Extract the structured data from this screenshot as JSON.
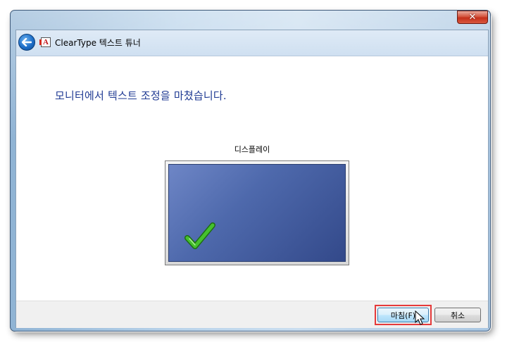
{
  "window": {
    "title": "ClearType 텍스트 튜너",
    "close_glyph": "✕"
  },
  "nav": {
    "back_icon": "back-arrow-icon",
    "app_icon_label": "A"
  },
  "main": {
    "heading": "모니터에서 텍스트 조정을 마쳤습니다.",
    "display_label": "디스플레이"
  },
  "footer": {
    "finish_label": "마침(F)",
    "cancel_label": "취소"
  },
  "colors": {
    "heading": "#1f3a93",
    "highlight": "#e53a3a",
    "check": "#3fae2a"
  }
}
